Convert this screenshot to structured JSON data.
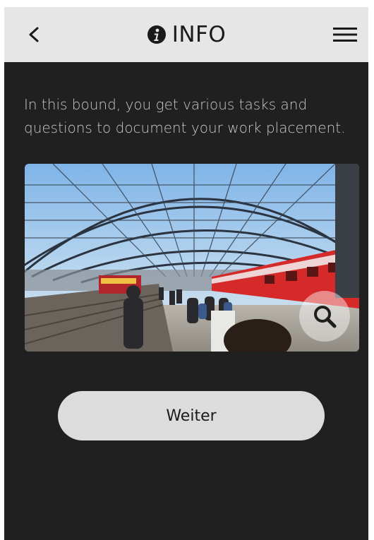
{
  "header": {
    "title": "INFO",
    "back_icon": "chevron-left-icon",
    "info_icon": "info-circle-icon",
    "menu_icon": "hamburger-menu-icon"
  },
  "main": {
    "intro_text": "In this bound, you get various tasks and questions to document your work placement.",
    "image": {
      "description_icon": "railway-station-photo",
      "zoom_icon": "magnifier-icon"
    },
    "continue_button": "Weiter"
  },
  "colors": {
    "header_bg": "#e6e6e6",
    "content_bg": "#202020",
    "text": "#c8c8c8",
    "button_bg": "#dcdcdc"
  }
}
